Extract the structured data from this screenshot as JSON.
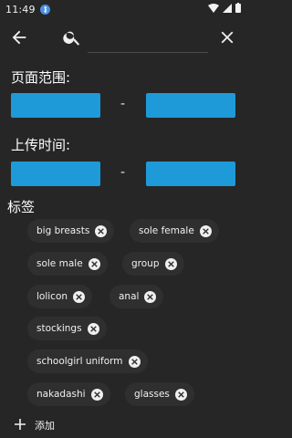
{
  "status_bar": {
    "time": "11:49"
  },
  "toolbar": {
    "search_placeholder": ""
  },
  "page_range": {
    "label": "页面范围:",
    "from": "",
    "to": "",
    "separator": "-"
  },
  "upload_time": {
    "label": "上传时间:",
    "from": "",
    "to": "",
    "separator": "-"
  },
  "tags": {
    "label": "标签",
    "items": [
      "big breasts",
      "sole female",
      "sole male",
      "group",
      "lolicon",
      "anal",
      "stockings",
      "schoolgirl uniform",
      "nakadashi",
      "glasses"
    ],
    "add_label": "添加"
  }
}
